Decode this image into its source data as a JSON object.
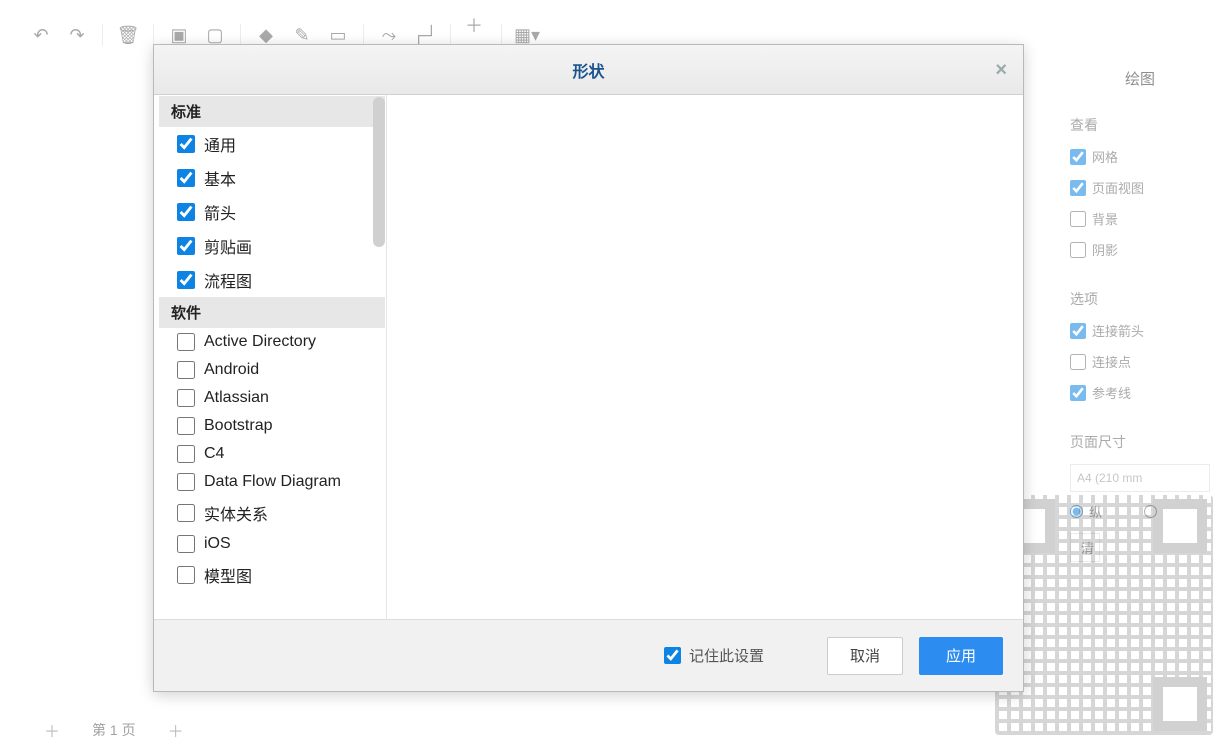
{
  "toolbar": {
    "items": [
      "undo",
      "redo",
      "sep",
      "delete",
      "sep",
      "front",
      "back",
      "sep",
      "fill",
      "stroke",
      "shadow",
      "sep",
      "connector",
      "waypoint",
      "sep",
      "plus",
      "sep",
      "grid"
    ]
  },
  "rightPanel": {
    "title": "绘图",
    "sections": {
      "view": {
        "title": "查看",
        "items": [
          {
            "key": "grid",
            "label": "网格",
            "checked": true
          },
          {
            "key": "pageview",
            "label": "页面视图",
            "checked": true
          },
          {
            "key": "background",
            "label": "背景",
            "checked": false
          },
          {
            "key": "shadow",
            "label": "阴影",
            "checked": false
          }
        ]
      },
      "options": {
        "title": "选项",
        "items": [
          {
            "key": "connarrows",
            "label": "连接箭头",
            "checked": true
          },
          {
            "key": "connpoints",
            "label": "连接点",
            "checked": false
          },
          {
            "key": "guides",
            "label": "参考线",
            "checked": true
          }
        ]
      },
      "pageSize": {
        "title": "页面尺寸",
        "value": "A4 (210 mm",
        "orientationLabel": "纵",
        "clearLabel": "清"
      }
    }
  },
  "dialog": {
    "title": "形状",
    "categories": [
      {
        "title": "标准",
        "items": [
          {
            "key": "general",
            "label": "通用",
            "checked": true
          },
          {
            "key": "basic",
            "label": "基本",
            "checked": true
          },
          {
            "key": "arrows",
            "label": "箭头",
            "checked": true
          },
          {
            "key": "clipart",
            "label": "剪贴画",
            "checked": true
          },
          {
            "key": "flowchart",
            "label": "流程图",
            "checked": true
          }
        ]
      },
      {
        "title": "软件",
        "items": [
          {
            "key": "ad",
            "label": "Active Directory",
            "checked": false
          },
          {
            "key": "android",
            "label": "Android",
            "checked": false
          },
          {
            "key": "atlassian",
            "label": "Atlassian",
            "checked": false
          },
          {
            "key": "bootstrap",
            "label": "Bootstrap",
            "checked": false
          },
          {
            "key": "c4",
            "label": "C4",
            "checked": false
          },
          {
            "key": "dfd",
            "label": "Data Flow Diagram",
            "checked": false
          },
          {
            "key": "er",
            "label": "实体关系",
            "checked": false
          },
          {
            "key": "ios",
            "label": "iOS",
            "checked": false
          },
          {
            "key": "mockup",
            "label": "模型图",
            "checked": false
          }
        ]
      }
    ],
    "footer": {
      "remember": "记住此设置",
      "cancel": "取消",
      "apply": "应用"
    }
  },
  "bottomTabs": {
    "page1": "第 1 页"
  }
}
